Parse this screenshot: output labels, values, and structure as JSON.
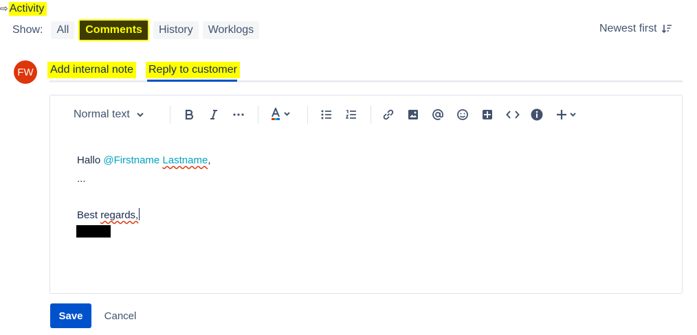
{
  "activity": {
    "title": "Activity",
    "arrow_glyph": "⇨"
  },
  "filters": {
    "show_label": "Show:",
    "items": [
      "All",
      "Comments",
      "History",
      "Worklogs"
    ],
    "active": "Comments",
    "sort_label": "Newest first"
  },
  "avatar": {
    "initials": "FW",
    "color": "#de350b"
  },
  "tabs": [
    {
      "label": "Add internal note"
    },
    {
      "label": "Reply to customer",
      "active": true
    }
  ],
  "toolbar": {
    "text_style": "Normal text",
    "icons": [
      "bold-icon",
      "italic-icon",
      "more-formatting-icon",
      "text-color-icon",
      "bullet-list-icon",
      "numbered-list-icon",
      "link-icon",
      "image-icon",
      "mention-icon",
      "emoji-icon",
      "table-icon",
      "code-icon",
      "info-panel-icon",
      "insert-plus-icon"
    ]
  },
  "content": {
    "greeting": "Hallo ",
    "mention_first": "@Firstname",
    "mention_last": "Lastname",
    "comma": ",",
    "ellipsis": "...",
    "closing_word": "Best ",
    "closing_misspelled": "regards,"
  },
  "actions": {
    "save": "Save",
    "cancel": "Cancel"
  },
  "colors": {
    "accent": "#0052cc",
    "highlight": "#ffff00",
    "mention": "#00a3bf"
  }
}
